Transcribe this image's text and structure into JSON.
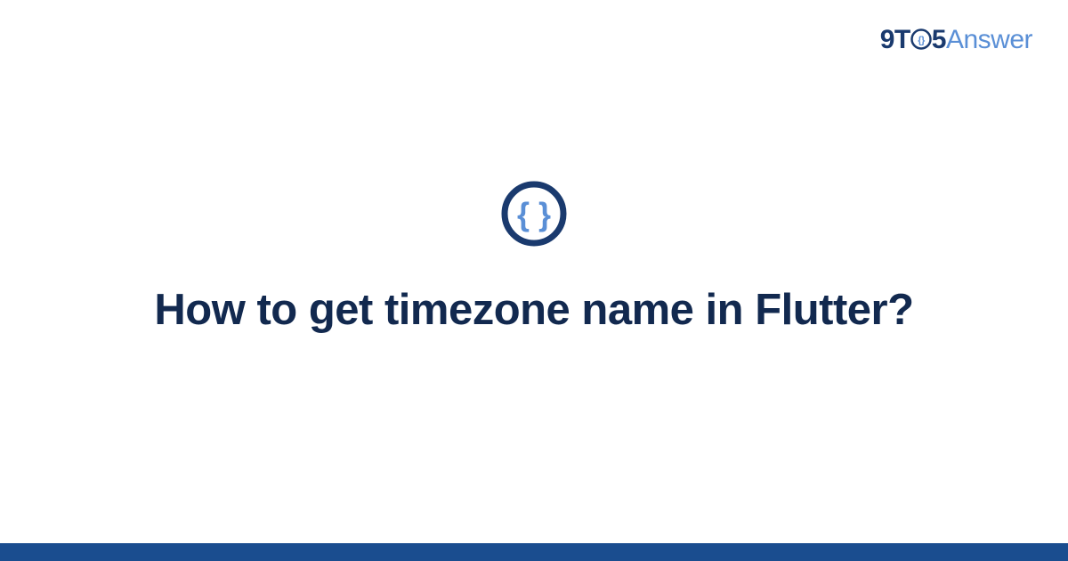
{
  "brand": {
    "part1": "9T",
    "part2": "5",
    "part3": "Answer"
  },
  "icon": {
    "name": "curly-braces-icon"
  },
  "question": {
    "title": "How to get timezone name in Flutter?"
  },
  "colors": {
    "dark_navy": "#12294f",
    "navy": "#1a3a6e",
    "light_blue": "#5a8fd6",
    "footer_blue": "#1a4d8f"
  }
}
